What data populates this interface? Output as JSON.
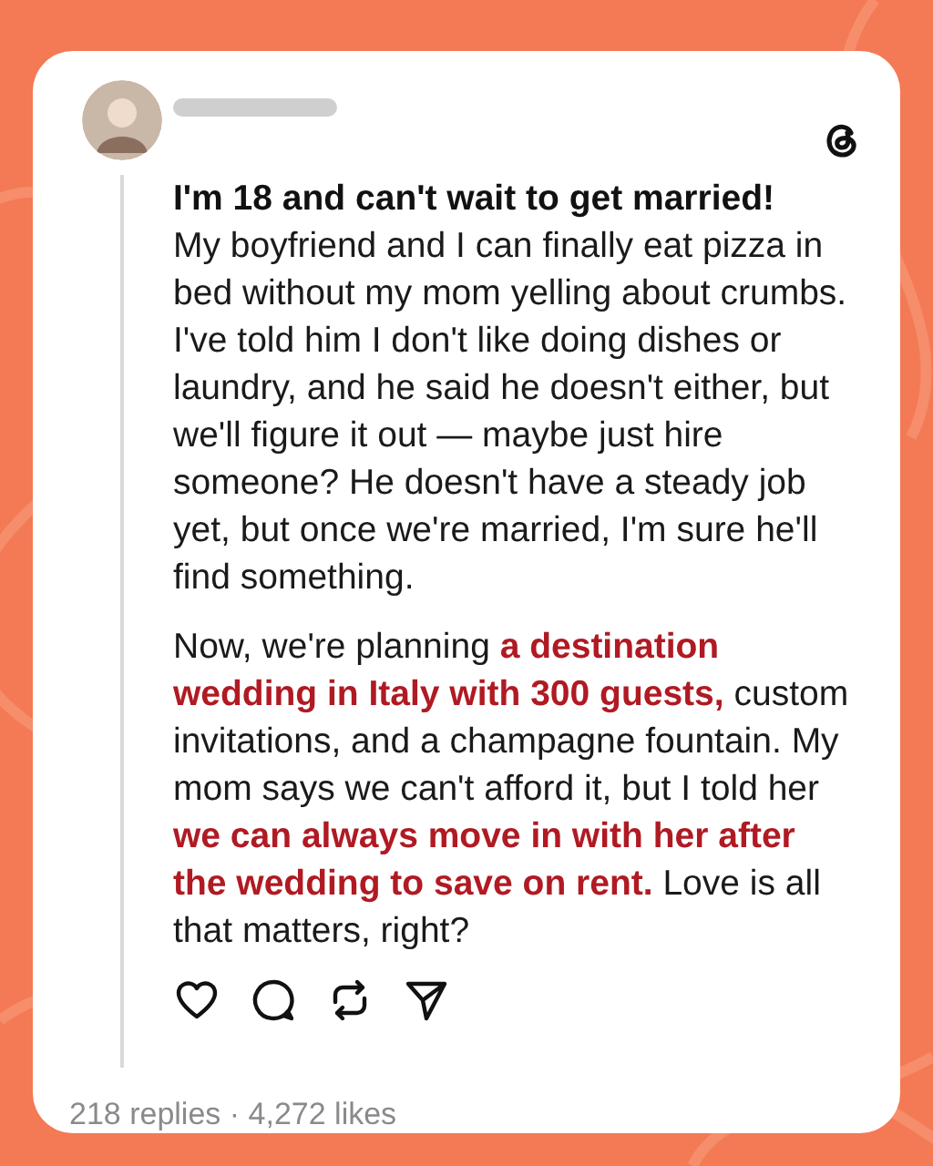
{
  "post": {
    "title": "I'm 18 and can't wait to get married!",
    "paragraphs": [
      {
        "segments": [
          {
            "text": "My boyfriend and I can finally eat pizza in bed without my mom yelling about crumbs. I've told him I don't like doing dishes or laundry, and he said he doesn't either, but we'll figure it out — maybe just hire someone? He doesn't have a steady job yet, but once we're married, I'm sure he'll find something.",
            "highlighted": false
          }
        ]
      },
      {
        "segments": [
          {
            "text": "Now, we're planning ",
            "highlighted": false
          },
          {
            "text": "a destination wedding in Italy with 300 guests,",
            "highlighted": true
          },
          {
            "text": " custom invitations, and a champagne fountain. My mom says we can't afford it, but I told her ",
            "highlighted": false
          },
          {
            "text": "we can always move in with her after the wedding to save on rent.",
            "highlighted": true
          },
          {
            "text": " Love is all that matters, right?",
            "highlighted": false
          }
        ]
      }
    ],
    "actions": [
      {
        "kind": "like"
      },
      {
        "kind": "reply"
      },
      {
        "kind": "repost"
      },
      {
        "kind": "share"
      }
    ],
    "stats": "218 replies · 4,272 likes"
  }
}
